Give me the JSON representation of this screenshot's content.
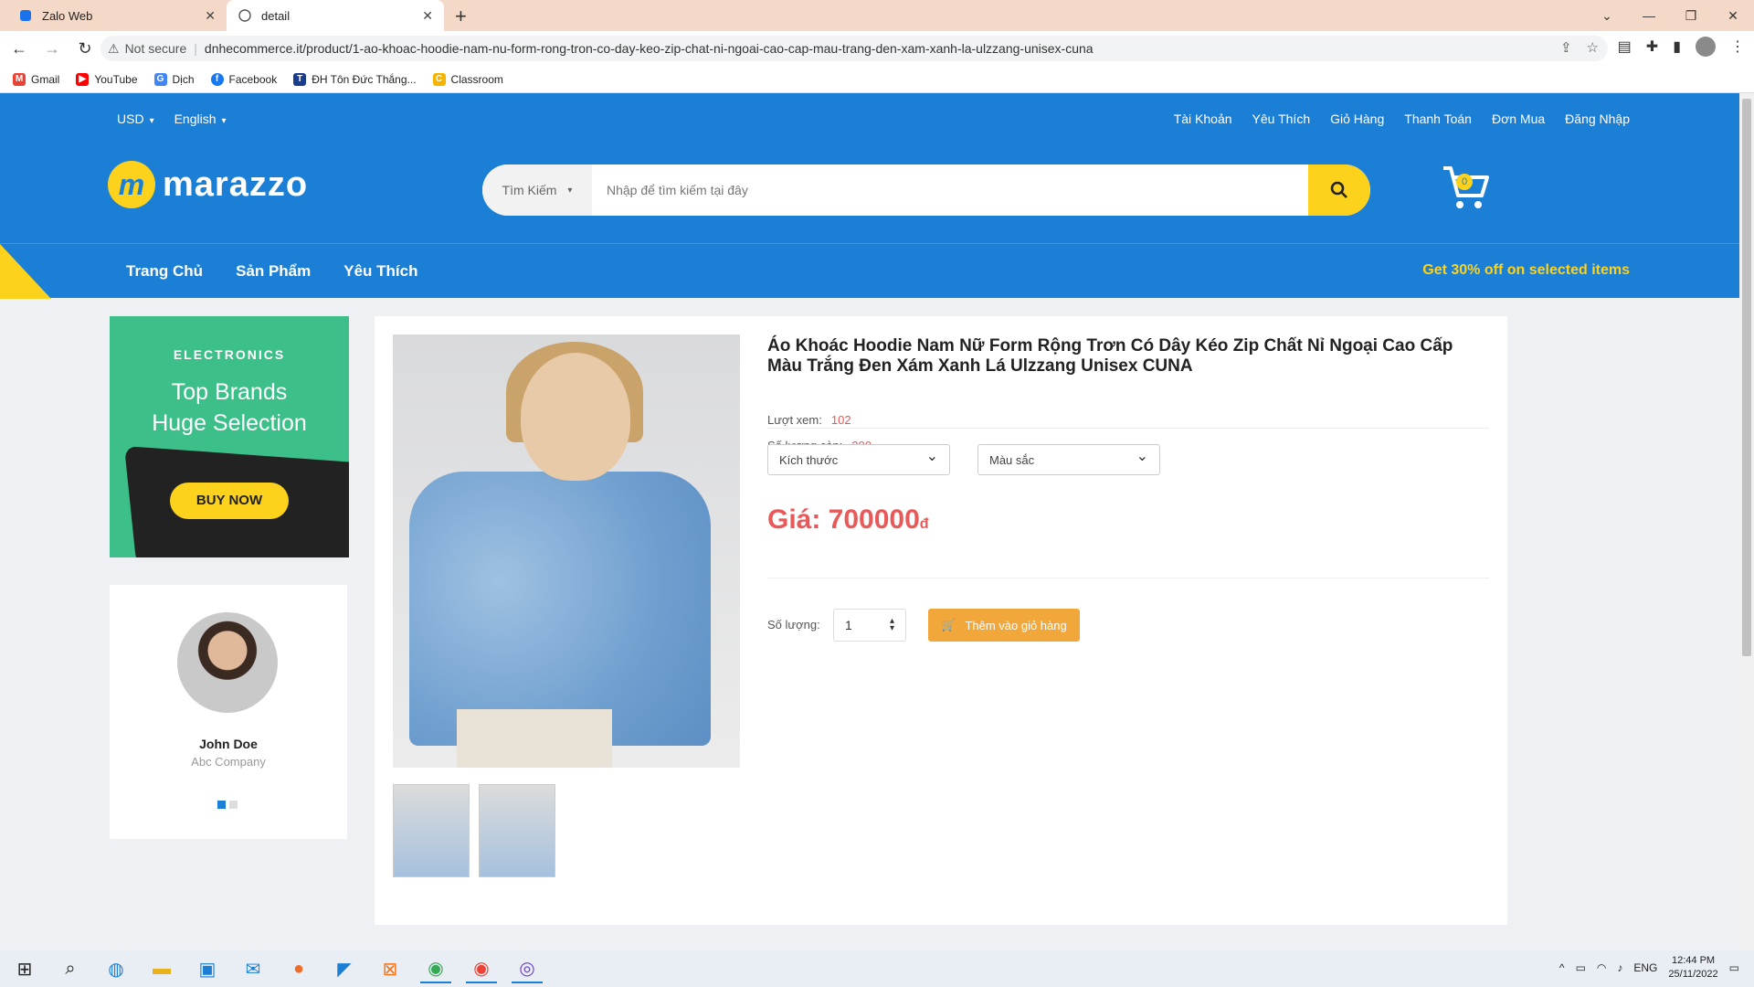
{
  "browser": {
    "tabs": [
      {
        "title": "Zalo Web",
        "icon": "zalo-icon"
      },
      {
        "title": "detail",
        "icon": "globe-icon"
      }
    ],
    "address": {
      "warning": "Not secure",
      "url": "dnhecommerce.it/product/1-ao-khoac-hoodie-nam-nu-form-rong-tron-co-day-keo-zip-chat-ni-ngoai-cao-cap-mau-trang-den-xam-xanh-la-ulzzang-unisex-cuna"
    },
    "bookmarks": [
      {
        "label": "Gmail",
        "icon": "gmail-icon"
      },
      {
        "label": "YouTube",
        "icon": "youtube-icon"
      },
      {
        "label": "Dịch",
        "icon": "translate-icon"
      },
      {
        "label": "Facebook",
        "icon": "facebook-icon"
      },
      {
        "label": "ĐH Tôn Đức Thắng...",
        "icon": "tdtu-icon"
      },
      {
        "label": "Classroom",
        "icon": "classroom-icon"
      }
    ]
  },
  "site": {
    "top_left": {
      "currency": "USD",
      "language": "English"
    },
    "top_links": [
      "Tài Khoản",
      "Yêu Thích",
      "Giỏ Hàng",
      "Thanh Toán",
      "Đơn Mua",
      "Đăng Nhập"
    ],
    "logo": {
      "text": "marazzo",
      "mark": "m"
    },
    "search": {
      "category": "Tìm Kiếm",
      "placeholder": "Nhập để tìm kiếm tại đây"
    },
    "cart": {
      "count": "0"
    },
    "menu": [
      "Trang Chủ",
      "Sản Phẩm",
      "Yêu Thích"
    ],
    "promo": "Get 30% off on selected items",
    "colors": {
      "primary": "#1c7fd6",
      "accent": "#fcd21d",
      "price": "#e85a59",
      "button": "#f2a73a"
    }
  },
  "sidebar": {
    "banner": {
      "category": "ELECTRONICS",
      "line1": "Top Brands",
      "line2": "Huge Selection",
      "button": "BUY NOW"
    },
    "testimonial": {
      "name": "John Doe",
      "company": "Abc Company"
    }
  },
  "product": {
    "title": "Áo Khoác Hoodie Nam Nữ Form Rộng Trơn Có Dây Kéo Zip Chất Nỉ Ngoại Cao Cấp Màu Trắng Đen Xám Xanh Lá Ulzzang Unisex CUNA",
    "views_label": "Lượt xem:",
    "views": "102",
    "stock_label": "Số lượng còn:",
    "stock": "200",
    "size_select": "Kích thước",
    "color_select": "Màu sắc",
    "price_label": "Giá: 700000",
    "currency": "đ",
    "qty_label": "Số lượng:",
    "qty": "1",
    "add_to_cart": "Thêm vào giỏ hàng"
  },
  "taskbar": {
    "lang": "ENG",
    "time": "12:44 PM",
    "date": "25/11/2022"
  }
}
